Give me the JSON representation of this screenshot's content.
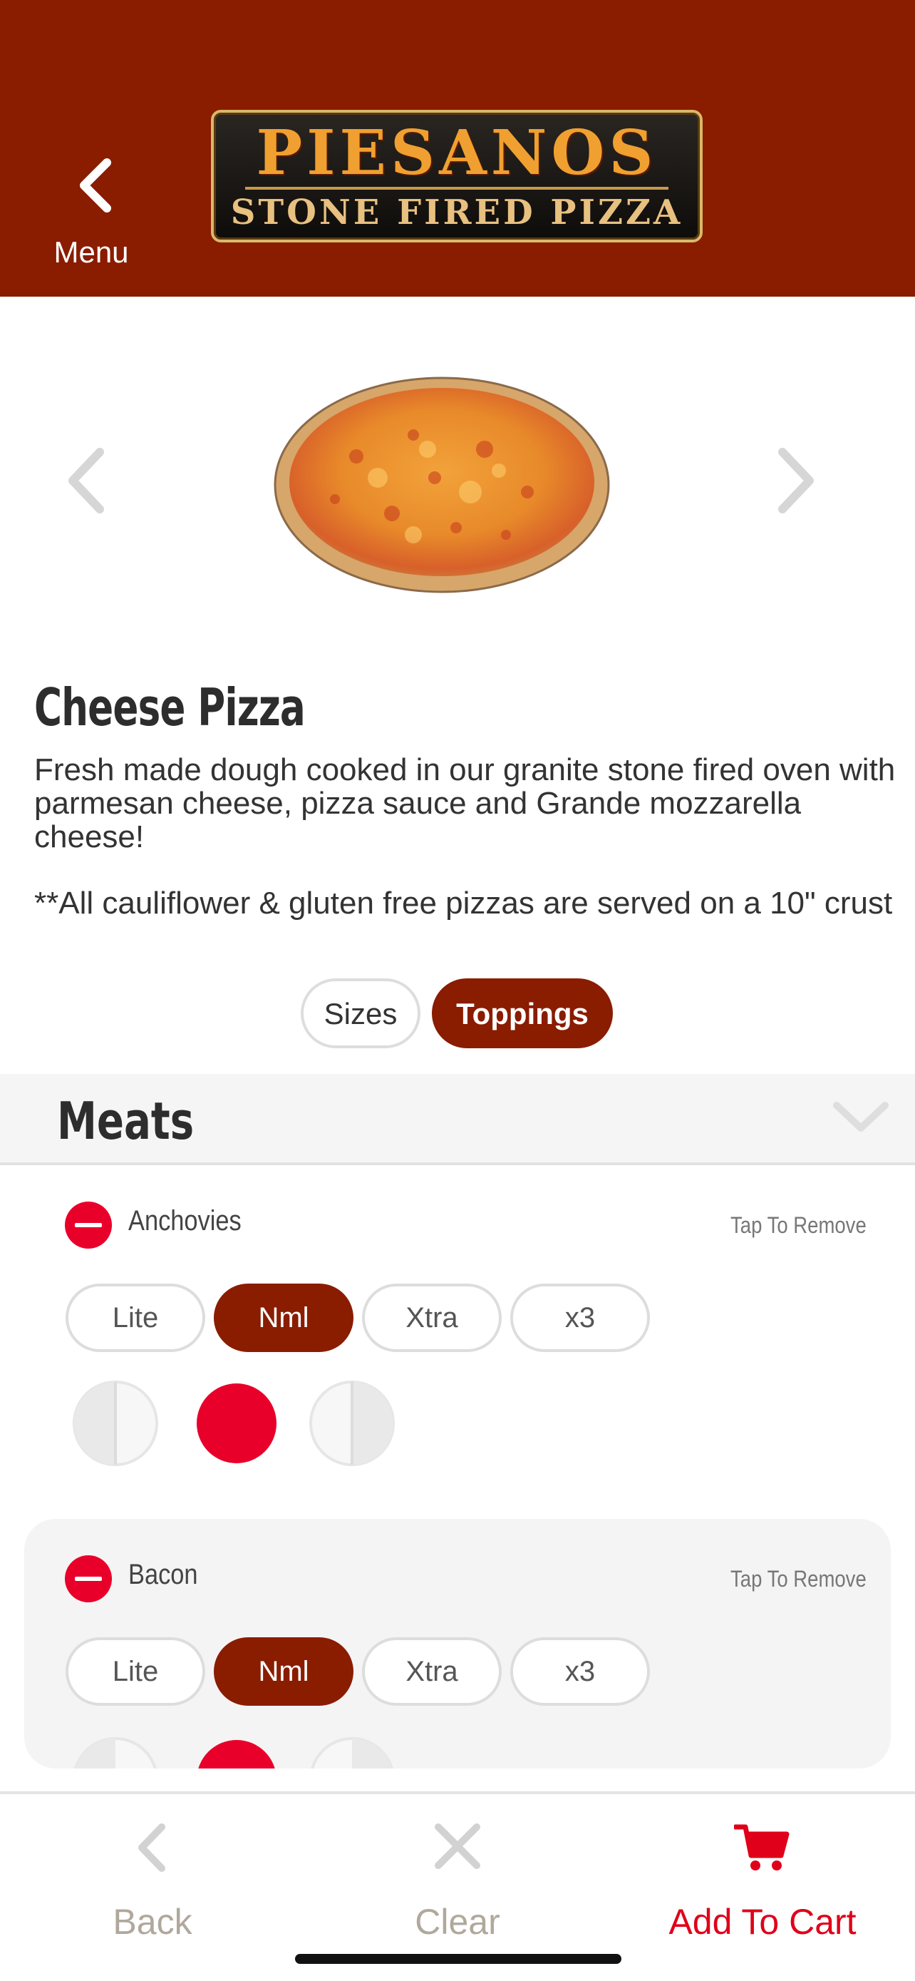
{
  "header": {
    "back_label": "Menu",
    "logo_line1": "PIESANOS",
    "logo_line2": "STONE FIRED PIZZA"
  },
  "product": {
    "title": "Cheese Pizza",
    "description": "Fresh made dough cooked in our granite stone fired oven with parmesan cheese, pizza sauce and Grande mozzarella cheese!",
    "note": "**All cauliflower & gluten free pizzas are served on a 10\" crust"
  },
  "tabs": {
    "sizes": "Sizes",
    "toppings": "Toppings",
    "active": "Toppings"
  },
  "section": {
    "title": "Meats"
  },
  "toppings": [
    {
      "name": "Anchovies",
      "remove_label": "Tap To Remove",
      "selected_amount": "Nml"
    },
    {
      "name": "Bacon",
      "remove_label": "Tap To Remove",
      "selected_amount": "Nml"
    }
  ],
  "amount_options": [
    "Lite",
    "Nml",
    "Xtra",
    "x3"
  ],
  "bottom_bar": {
    "back": "Back",
    "clear": "Clear",
    "add_to_cart": "Add To Cart"
  },
  "colors": {
    "brand": "#8a1c00",
    "accent": "#e8002a",
    "cart": "#e0001a"
  },
  "icons": {
    "back": "chevron-left-icon",
    "gallery_prev": "chevron-left-icon",
    "gallery_next": "chevron-right-icon",
    "section_toggle": "chevron-down-icon",
    "remove": "minus-circle-icon",
    "clear": "close-icon",
    "cart": "cart-icon"
  }
}
